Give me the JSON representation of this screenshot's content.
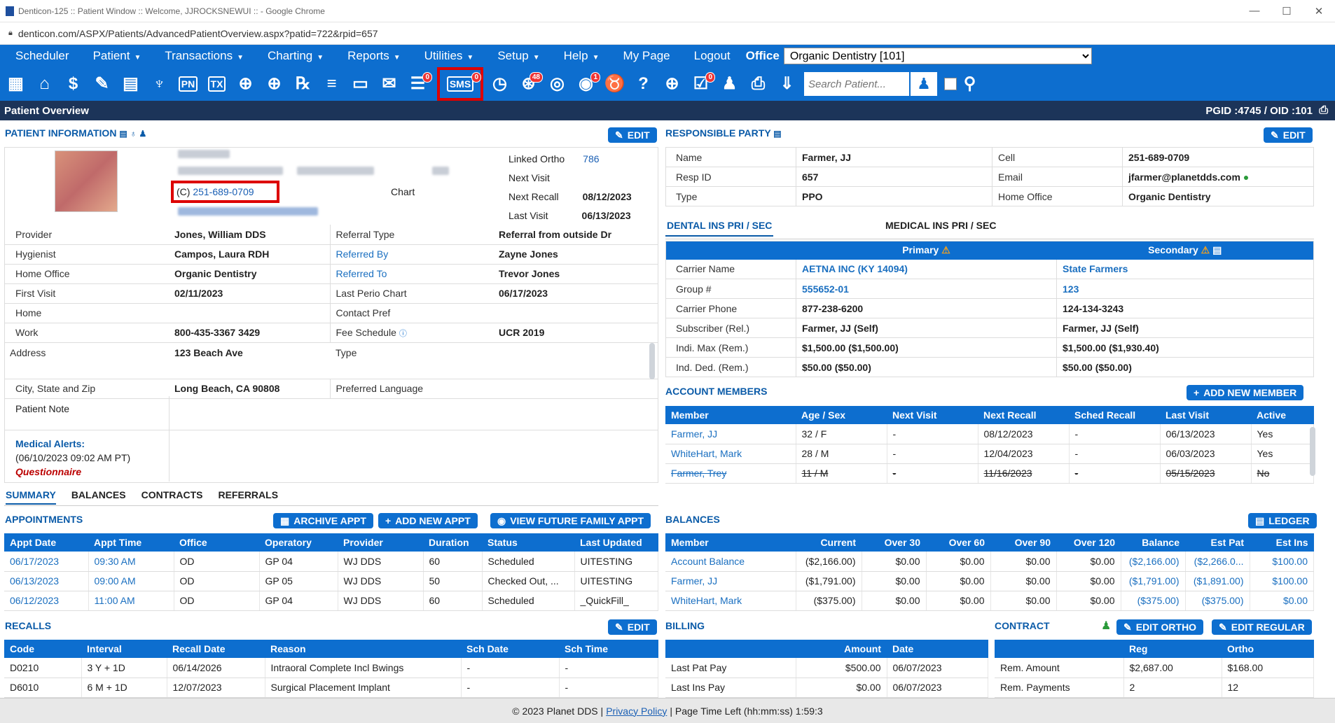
{
  "browser": {
    "title": "Denticon-125 :: Patient Window :: Welcome, JJROCKSNEWUI :: - Google Chrome",
    "url": "denticon.com/ASPX/Patients/AdvancedPatientOverview.aspx?patid=722&rpid=657",
    "controls": [
      "—",
      "☐",
      "✕"
    ]
  },
  "nav": {
    "items": [
      "Scheduler",
      "Patient",
      "Transactions",
      "Charting",
      "Reports",
      "Utilities",
      "Setup",
      "Help",
      "My Page",
      "Logout"
    ],
    "office_label": "Office",
    "office_value": "Organic Dentistry [101]"
  },
  "toolbar": {
    "icons": [
      {
        "name": "calendar-icon",
        "glyph": "▦",
        "badge": ""
      },
      {
        "name": "home-icon",
        "glyph": "⌂",
        "badge": ""
      },
      {
        "name": "dollar-icon",
        "glyph": "$",
        "badge": ""
      },
      {
        "name": "notes-edit-icon",
        "glyph": "✎",
        "badge": ""
      },
      {
        "name": "tooth-chart-icon",
        "glyph": "▤",
        "badge": ""
      },
      {
        "name": "tooth-icon",
        "glyph": "♆",
        "badge": ""
      },
      {
        "name": "pn-icon",
        "text": "PN",
        "badge": ""
      },
      {
        "name": "tx-icon",
        "text": "TX",
        "badge": ""
      },
      {
        "name": "add-patient-icon",
        "glyph": "⊕",
        "badge": ""
      },
      {
        "name": "add-family-icon",
        "glyph": "⊕",
        "badge": ""
      },
      {
        "name": "rx-icon",
        "glyph": "℞",
        "badge": ""
      },
      {
        "name": "list-icon",
        "glyph": "≡",
        "badge": ""
      },
      {
        "name": "scanner-icon",
        "glyph": "▭",
        "badge": ""
      },
      {
        "name": "mail-icon",
        "glyph": "✉",
        "badge": ""
      },
      {
        "name": "messages-icon",
        "glyph": "☰",
        "badge": "0"
      }
    ],
    "sms": {
      "name": "sms-icon",
      "text": "SMS",
      "badge": "0"
    },
    "icons2": [
      {
        "name": "clock-icon",
        "glyph": "◷",
        "badge": ""
      },
      {
        "name": "web-alert-icon",
        "glyph": "⊛",
        "badge": "48"
      },
      {
        "name": "patient-portal-icon",
        "glyph": "◎",
        "badge": ""
      },
      {
        "name": "patient-alert-icon",
        "glyph": "◉",
        "badge": "1"
      },
      {
        "name": "tooth-outline-icon",
        "glyph": "♉",
        "badge": ""
      },
      {
        "name": "tooth-question-icon",
        "glyph": "?",
        "badge": ""
      },
      {
        "name": "globe-pointer-icon",
        "glyph": "⊕",
        "badge": ""
      },
      {
        "name": "checklist-icon",
        "glyph": "☑",
        "badge": "0"
      },
      {
        "name": "people-icon",
        "glyph": "♟",
        "badge": ""
      },
      {
        "name": "printer-icon",
        "glyph": "⎙",
        "badge": ""
      },
      {
        "name": "download-icon",
        "glyph": "⇓",
        "badge": ""
      }
    ],
    "search_placeholder": "Search Patient..."
  },
  "subbar": {
    "title": "Patient Overview",
    "ids": "PGID :4745  /  OID :101"
  },
  "patient_info": {
    "title": "PATIENT INFORMATION",
    "edit": "EDIT",
    "cell_label": "(C)",
    "cell_phone": "251-689-0709",
    "chart_label": "Chart",
    "linked_ortho_label": "Linked Ortho",
    "linked_ortho_value": "786",
    "next_visit_label": "Next Visit",
    "next_visit_value": "",
    "next_recall_label": "Next Recall",
    "next_recall_value": "08/12/2023",
    "last_visit_label": "Last Visit",
    "last_visit_value": "06/13/2023",
    "rows": [
      {
        "l1": "Provider",
        "v1": "Jones, William DDS",
        "l2": "Referral Type",
        "v2": "Referral from outside Dr"
      },
      {
        "l1": "Hygienist",
        "v1": "Campos, Laura RDH",
        "l2": "Referred By",
        "v2": "Zayne Jones"
      },
      {
        "l1": "Home Office",
        "v1": "Organic Dentistry",
        "l2": "Referred To",
        "v2": "Trevor Jones"
      },
      {
        "l1": "First Visit",
        "v1": "02/11/2023",
        "l2": "Last Perio Chart",
        "v2": "06/17/2023"
      },
      {
        "l1": "Home",
        "v1": "",
        "l2": "Contact Pref",
        "v2": ""
      },
      {
        "l1": "Work",
        "v1": "800-435-3367 3429",
        "l2": "Fee Schedule",
        "v2": "UCR 2019"
      },
      {
        "l1": "Address",
        "v1": "123 Beach Ave",
        "l2": "Type",
        "v2": ""
      },
      {
        "l1": "City, State and Zip",
        "v1": "Long Beach, CA 90808",
        "l2": "Preferred Language",
        "v2": ""
      }
    ],
    "patient_note_label": "Patient Note",
    "medical_alerts_label": "Medical Alerts:",
    "medical_alerts_date": "(06/10/2023 09:02 AM PT)",
    "questionnaire": "Questionnaire"
  },
  "responsible_party": {
    "title": "RESPONSIBLE PARTY",
    "edit": "EDIT",
    "rows": [
      {
        "l1": "Name",
        "v1": "Farmer, JJ",
        "l2": "Cell",
        "v2": "251-689-0709"
      },
      {
        "l1": "Resp ID",
        "v1": "657",
        "l2": "Email",
        "v2": "jfarmer@planetdds.com"
      },
      {
        "l1": "Type",
        "v1": "PPO",
        "l2": "Home Office",
        "v2": "Organic Dentistry"
      }
    ]
  },
  "insurance": {
    "tab_dental": "DENTAL INS PRI / SEC",
    "tab_medical": "MEDICAL INS PRI / SEC",
    "primary": "Primary",
    "secondary": "Secondary",
    "rows": [
      {
        "label": "Carrier Name",
        "pri": "AETNA INC (KY 14094)",
        "sec": "State Farmers",
        "link": true
      },
      {
        "label": "Group #",
        "pri": "555652-01",
        "sec": "123",
        "link": true
      },
      {
        "label": "Carrier Phone",
        "pri": "877-238-6200",
        "sec": "124-134-3243",
        "link": false
      },
      {
        "label": "Subscriber (Rel.)",
        "pri": "Farmer, JJ (Self)",
        "sec": "Farmer, JJ (Self)",
        "link": false
      },
      {
        "label": "Indi. Max (Rem.)",
        "pri": "$1,500.00 ($1,500.00)",
        "sec": "$1,500.00 ($1,930.40)",
        "link": false
      },
      {
        "label": "Ind. Ded. (Rem.)",
        "pri": "$50.00 ($50.00)",
        "sec": "$50.00 ($50.00)",
        "link": false
      }
    ]
  },
  "account_members": {
    "title": "ACCOUNT MEMBERS",
    "add_btn": "ADD NEW MEMBER",
    "headers": [
      "Member",
      "Age / Sex",
      "Next Visit",
      "Next Recall",
      "Sched Recall",
      "Last Visit",
      "Active"
    ],
    "rows": [
      [
        "Farmer, JJ",
        "32 / F",
        "-",
        "08/12/2023",
        "-",
        "06/13/2023",
        "Yes"
      ],
      [
        "WhiteHart, Mark",
        "28 / M",
        "-",
        "12/04/2023",
        "-",
        "06/03/2023",
        "Yes"
      ],
      [
        "Farmer, Trey",
        "11 / M",
        "-",
        "11/16/2023",
        "-",
        "05/15/2023",
        "No"
      ]
    ]
  },
  "tabs": [
    "SUMMARY",
    "BALANCES",
    "CONTRACTS",
    "REFERRALS"
  ],
  "appointments": {
    "title": "APPOINTMENTS",
    "archive_btn": "ARCHIVE APPT",
    "add_btn": "ADD NEW APPT",
    "future_btn": "VIEW FUTURE FAMILY APPT",
    "headers": [
      "Appt Date",
      "Appt Time",
      "Office",
      "Operatory",
      "Provider",
      "Duration",
      "Status",
      "Last Updated"
    ],
    "rows": [
      [
        "06/17/2023",
        "09:30 AM",
        "OD",
        "GP 04",
        "WJ DDS",
        "60",
        "Scheduled",
        "UITESTING"
      ],
      [
        "06/13/2023",
        "09:00 AM",
        "OD",
        "GP 05",
        "WJ DDS",
        "50",
        "Checked Out, ...",
        "UITESTING"
      ],
      [
        "06/12/2023",
        "11:00 AM",
        "OD",
        "GP 04",
        "WJ DDS",
        "60",
        "Scheduled",
        "_QuickFill_"
      ]
    ]
  },
  "balances": {
    "title": "BALANCES",
    "ledger_btn": "LEDGER",
    "headers": [
      "Member",
      "Current",
      "Over 30",
      "Over 60",
      "Over 90",
      "Over 120",
      "Balance",
      "Est Pat",
      "Est Ins"
    ],
    "rows": [
      [
        "Account Balance",
        "($2,166.00)",
        "$0.00",
        "$0.00",
        "$0.00",
        "$0.00",
        "($2,166.00)",
        "($2,266.0...",
        "$100.00"
      ],
      [
        "Farmer, JJ",
        "($1,791.00)",
        "$0.00",
        "$0.00",
        "$0.00",
        "$0.00",
        "($1,791.00)",
        "($1,891.00)",
        "$100.00"
      ],
      [
        "WhiteHart, Mark",
        "($375.00)",
        "$0.00",
        "$0.00",
        "$0.00",
        "$0.00",
        "($375.00)",
        "($375.00)",
        "$0.00"
      ]
    ]
  },
  "recalls": {
    "title": "RECALLS",
    "edit": "EDIT",
    "headers": [
      "Code",
      "Interval",
      "Recall Date",
      "Reason",
      "Sch Date",
      "Sch Time"
    ],
    "rows": [
      [
        "D0210",
        "3 Y + 1D",
        "06/14/2026",
        "Intraoral Complete Incl Bwings",
        "-",
        "-"
      ],
      [
        "D6010",
        "6 M + 1D",
        "12/07/2023",
        "Surgical Placement Implant",
        "-",
        "-"
      ]
    ]
  },
  "billing": {
    "title": "BILLING",
    "headers": [
      "",
      "Amount",
      "Date"
    ],
    "rows": [
      [
        "Last Pat Pay",
        "$500.00",
        "06/07/2023"
      ],
      [
        "Last Ins Pay",
        "$0.00",
        "06/07/2023"
      ]
    ]
  },
  "contract": {
    "title": "CONTRACT",
    "edit_ortho": "EDIT ORTHO",
    "edit_regular": "EDIT REGULAR",
    "headers": [
      "",
      "Reg",
      "Ortho"
    ],
    "rows": [
      [
        "Rem. Amount",
        "$2,687.00",
        "$168.00"
      ],
      [
        "Rem. Payments",
        "2",
        "12"
      ]
    ]
  },
  "footer": {
    "copyright": "© 2023 Planet DDS |",
    "privacy": "Privacy Policy",
    "time_left": "| Page Time Left (hh:mm:ss) 1:59:3"
  },
  "colors": {
    "nav": "#0d6ecf",
    "subbar": "#1c3459",
    "highlight": "#dd0000"
  }
}
